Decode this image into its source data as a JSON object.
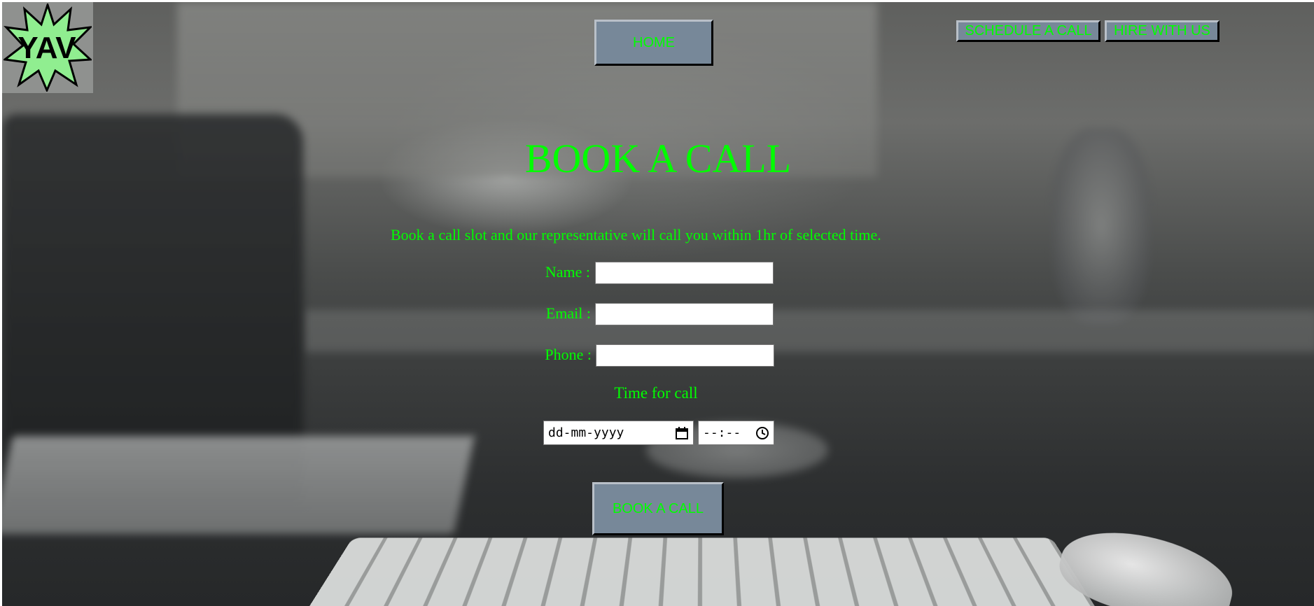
{
  "logo": {
    "text": "YAV",
    "icon": "comic-burst-logo",
    "accent": "#90ee90"
  },
  "nav": {
    "home_label": "HOME",
    "schedule_label": "SCHEDULE A CALL",
    "hire_label": "HIRE WITH US"
  },
  "main": {
    "title": "BOOK A CALL",
    "subtitle": "Book a call slot and our representative will call you within 1hr of selected time.",
    "form": {
      "name_label": "Name :",
      "email_label": "Email :",
      "phone_label": "Phone :",
      "time_label": "Time for call",
      "date_placeholder": "dd-mm-yyyy",
      "time_placeholder": "--:--",
      "submit_label": "BOOK A CALL"
    }
  },
  "colors": {
    "text": "#00ff00",
    "button_bg": "#778899"
  }
}
